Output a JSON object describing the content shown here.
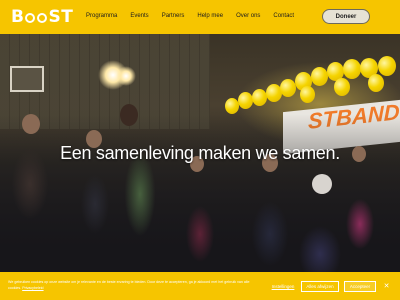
{
  "header": {
    "logo_text_left": "B",
    "logo_text_right": "ST",
    "nav": [
      {
        "label": "Programma"
      },
      {
        "label": "Events"
      },
      {
        "label": "Partners"
      },
      {
        "label": "Help mee"
      },
      {
        "label": "Over ons"
      },
      {
        "label": "Contact"
      }
    ],
    "donate_label": "Doneer"
  },
  "hero": {
    "title": "Een samenleving maken we samen.",
    "banner_text": "STBAND"
  },
  "cookie_bar": {
    "text": "We gebruiken cookies op onze website om je relevante en de beste ervaring te bieden. Door deze te accepteren, ga je akkoord met het gebruik van alle cookies.",
    "privacy_link": "Privacybeleid",
    "settings_label": "Instellingen",
    "reject_label": "Alles afwijzen",
    "accept_label": "Accepteer",
    "close_icon": "close-icon"
  },
  "colors": {
    "brand_yellow": "#f6c500",
    "text_dark": "#1d1d1d",
    "white": "#ffffff"
  }
}
